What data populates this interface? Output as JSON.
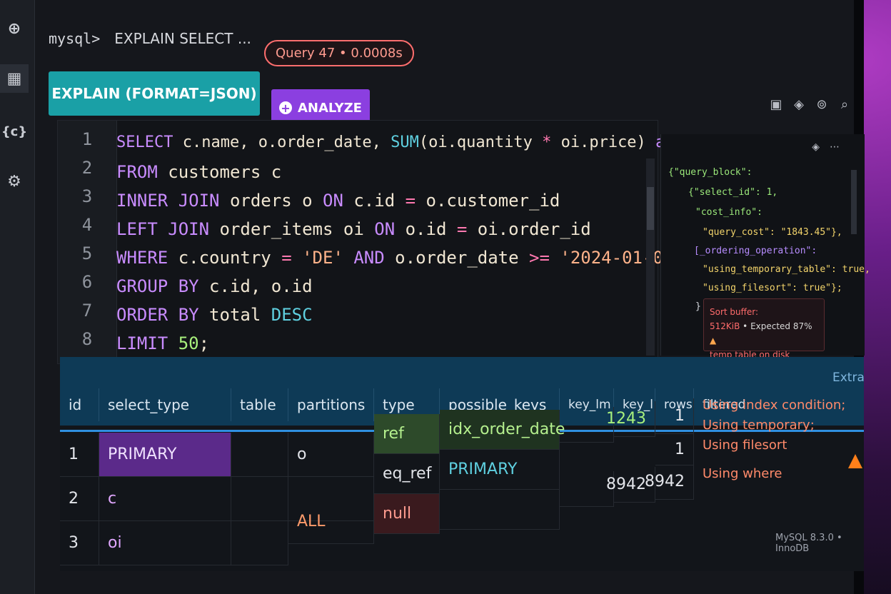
{
  "topbar": {
    "prompt": "mysql>",
    "command": "EXPLAIN SELECT ...",
    "query_badge": "Query 47 • 0.0008s"
  },
  "toolbar": {
    "explain_label": "EXPLAIN (FORMAT=JSON)",
    "analyze_label": "ANALYZE"
  },
  "editor": {
    "line_numbers": [
      "1",
      "2",
      "3",
      "4",
      "5",
      "6",
      "7",
      "8"
    ]
  },
  "json_panel": {
    "lines": [
      "{\"query_block\":",
      "{\"select_id\": 1,",
      "\"cost_info\":",
      "\"query_cost\": \"1843.45\"},",
      "[_ordering_operation\":",
      "\"using_temporary_table\": true,",
      "\"using_filesort\": true\"};",
      "}"
    ]
  },
  "tooltip": {
    "title": "Sort buffer:",
    "size": "512KiB",
    "expected": "• Expected 87%",
    "note": "temp table on disk"
  },
  "results": {
    "headers": [
      "id",
      "select_type",
      "table",
      "partitions",
      "type",
      "possible_keys",
      "key_lm",
      "key_l",
      "rows",
      "filtered",
      "Extra"
    ],
    "rows": [
      {
        "id": "1",
        "select_type": "PRIMARY",
        "table": "",
        "partitions": "o",
        "type": "ref",
        "possible_keys": "idx_order_date",
        "key_lm": "",
        "key_l": "1243",
        "rows": "1",
        "extra": [
          "Using index condition;",
          "Using temporary;",
          "Using filesort"
        ]
      },
      {
        "id": "2",
        "select_type": "c",
        "table": "",
        "partitions": "",
        "type": "eq_ref",
        "possible_keys": "PRIMARY",
        "key_lm": "",
        "key_l": "8942",
        "rows": "8942",
        "extra": [
          "Using where"
        ]
      },
      {
        "id": "3",
        "select_type": "oi",
        "table": "",
        "partitions": "ALL",
        "type": "null",
        "possible_keys": "",
        "key_lm": "",
        "key_l": "",
        "rows": "",
        "extra": []
      }
    ],
    "row2_rows_extra": "1"
  },
  "footer": {
    "version": "MySQL 8.3.0 • InnoDB"
  },
  "colors": {
    "accent_teal": "#1aa0a6",
    "accent_purple": "#8b3fe0",
    "header_blue": "#0e3a56"
  }
}
